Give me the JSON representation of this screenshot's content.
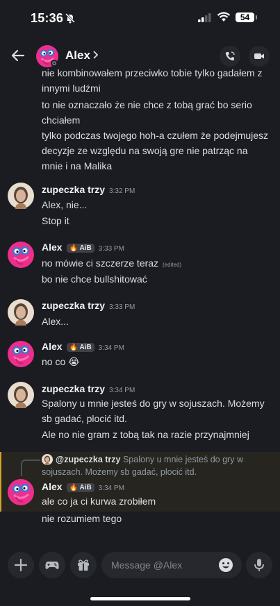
{
  "status_bar": {
    "time": "15:36",
    "battery": "54"
  },
  "header": {
    "title": "Alex"
  },
  "chat": {
    "top_messages": [
      "nie kombinowałem przeciwko tobie tylko gadałem z innymi ludźmi",
      "to nie oznaczało że nie chce z tobą grać bo serio chciałem",
      "tylko podczas twojego hoh-a czułem że podejmujesz decyzje ze względu na swoją gre nie patrząc na mnie i na Malika"
    ],
    "groups": [
      {
        "author": "zupeczka trzy",
        "time": "3:32 PM",
        "messages": [
          "Alex, nie...",
          "Stop it"
        ]
      },
      {
        "author": "Alex",
        "tag": "AiB",
        "time": "3:33 PM",
        "messages": [
          "no mówie ci szczerze teraz",
          "bo nie chce bullshitować"
        ],
        "edited": "(edited)"
      },
      {
        "author": "zupeczka trzy",
        "time": "3:33 PM",
        "messages": [
          "Alex..."
        ]
      },
      {
        "author": "Alex",
        "tag": "AiB",
        "time": "3:34 PM",
        "messages": [
          "no co 😭"
        ]
      },
      {
        "author": "zupeczka trzy",
        "time": "3:34 PM",
        "messages": [
          "Spalony u mnie jesteś do gry w sojuszach. Możemy sb gadać, plocić itd.",
          "Ale no nie gram z tobą tak na razie przynajmniej"
        ]
      },
      {
        "author": "Alex",
        "tag": "AiB",
        "time": "3:34 PM",
        "messages": [
          "ale co ja ci kurwa zrobiłem",
          "nie rozumiem tego"
        ]
      }
    ],
    "reply": {
      "name": "@zupeczka trzy",
      "text_line1": "Spalony u mnie jesteś do gry w",
      "text_line2": "sojuszach. Możemy sb gadać, plocić itd."
    }
  },
  "composer": {
    "placeholder": "Message @Alex"
  },
  "colors": {
    "background": "#1b1c21",
    "mention_highlight": "#26251f",
    "mention_accent": "#d4a12c"
  },
  "icons": [
    "bell-slash-icon",
    "signal-icon",
    "wifi-icon",
    "back-arrow-icon",
    "chevron-right-icon",
    "phone-icon",
    "video-icon",
    "plus-icon",
    "gamepad-icon",
    "gift-icon",
    "emoji-icon",
    "microphone-icon"
  ]
}
